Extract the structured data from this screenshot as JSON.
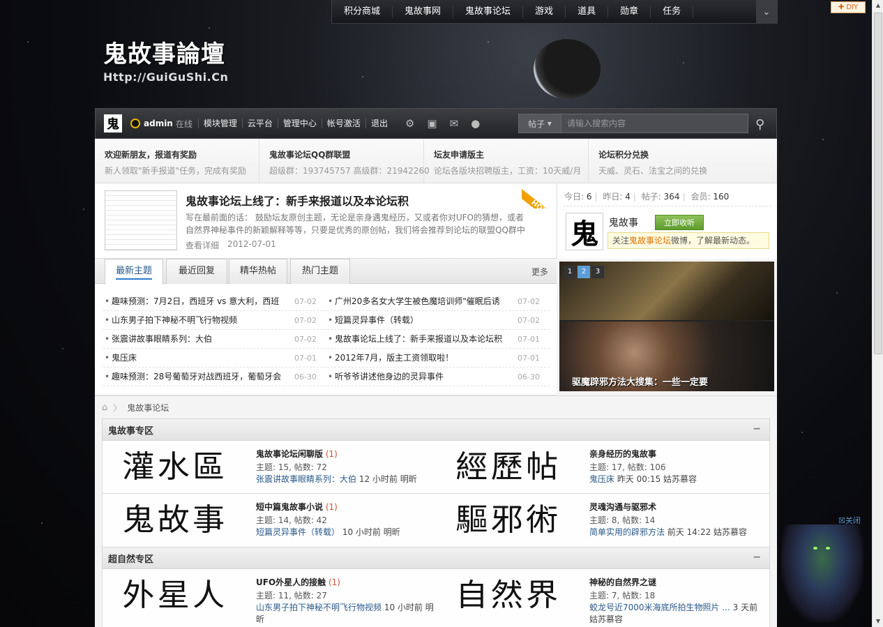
{
  "topnav": {
    "items": [
      "积分商城",
      "鬼故事网",
      "鬼故事论坛",
      "游戏",
      "道具",
      "勋章",
      "任务"
    ],
    "dropdown": "⌄",
    "diy": "✚ DIY"
  },
  "logo": {
    "title": "鬼故事論壇",
    "url": "Http://GuiGuShi.Cn"
  },
  "userbar": {
    "avatar_char": "鬼",
    "username": "admin",
    "status": "在线",
    "links": [
      "模块管理",
      "云平台",
      "管理中心",
      "帐号激活",
      "退出"
    ],
    "search_type": "帖子",
    "search_placeholder": "请输入搜索内容",
    "icons": [
      "gear-icon",
      "image-icon",
      "mail-icon",
      "bulb-icon",
      "search-icon"
    ]
  },
  "notices": [
    {
      "title": "欢迎新朋友，报道有奖励",
      "desc": "新人领取\"新手报道\"任务，完成有奖励"
    },
    {
      "title": "鬼故事论坛QQ群联盟",
      "desc": "超级群：193745757 高级群：21942260"
    },
    {
      "title": "坛友申请版主",
      "desc": "论坛各版块招聘版主，工资：10天威/月"
    },
    {
      "title": "论坛积分兑换",
      "desc": "天威、灵石、法宝之间的兑换"
    }
  ],
  "featured": {
    "title": "鬼故事论坛上线了：新手来报道以及本论坛积",
    "summary": "写在最前面的话： 鼓励坛友原创主题，无论是亲身遇鬼经历，又或者你对UFO的猜想，或者自然界神秘事件的新颖解释等等，只要是优秀的原创帖，我们将会推荐到论坛的联盟QQ群中 ...",
    "more": "查看详细",
    "date": "2012-07-01",
    "badge": "HOT"
  },
  "stats": {
    "today_label": "今日:",
    "today": "6",
    "yesterday_label": "昨日:",
    "yesterday": "4",
    "posts_label": "帖子:",
    "posts": "364",
    "members_label": "会员:",
    "members": "160",
    "weibo_char": "鬼",
    "weibo_name": "鬼故事",
    "listen": "立即收听",
    "follow_pre": "关注",
    "follow_hl": "鬼故事论坛",
    "follow_post": "微博，了解最新动态。"
  },
  "tabs": {
    "items": [
      "最新主题",
      "最近回复",
      "精华热帖",
      "热门主题"
    ],
    "more": "更多"
  },
  "threads": [
    [
      {
        "t": "趣味预测：7月2日，西班牙 vs 意大利，西班",
        "d": "07-02"
      },
      {
        "t": "广州20多名女大学生被色魔培训师\"催眠后诱",
        "d": "07-02"
      }
    ],
    [
      {
        "t": "山东男子拍下神秘不明飞行物视频",
        "d": "07-02"
      },
      {
        "t": "短篇灵异事件（转载）",
        "d": "07-02"
      }
    ],
    [
      {
        "t": "张震讲故事眼睛系列：大伯",
        "d": "07-02"
      },
      {
        "t": "鬼故事论坛上线了：新手来报道以及本论坛积",
        "d": "07-01"
      }
    ],
    [
      {
        "t": "鬼压床",
        "d": "07-01"
      },
      {
        "t": "2012年7月，版主工资领取啦！",
        "d": "07-01"
      }
    ],
    [
      {
        "t": "趣味预测：28号葡萄牙对战西班牙，葡萄牙会",
        "d": "06-30"
      },
      {
        "t": "听爷爷讲述他身边的灵异事件",
        "d": "06-30"
      }
    ]
  ],
  "slider": {
    "dots": [
      "1",
      "2",
      "3"
    ],
    "caption": "驱魔辟邪方法大搜集：一些一定要"
  },
  "breadcrumb": {
    "home": "⌂",
    "arrow": "〉",
    "current": "鬼故事论坛"
  },
  "sections": [
    {
      "title": "鬼故事专区",
      "collapse": "−",
      "forums": [
        {
          "glyph": "灌水區",
          "name": "鬼故事论坛闲聊版",
          "new": " (1)",
          "stat": "主题: 15, 帖数: 72",
          "last_link": "张震讲故事眼睛系列：大伯",
          "last_meta": " 12 小时前 明昕"
        },
        {
          "glyph": "經歷帖",
          "name": "亲身经历的鬼故事",
          "new": "",
          "stat": "主题: 17, 帖数: 106",
          "last_link": "鬼压床",
          "last_meta": " 昨天 00:15 姑苏慕容"
        },
        {
          "glyph": "鬼故事",
          "name": "短中篇鬼故事小说",
          "new": " (1)",
          "stat": "主题: 14, 帖数: 42",
          "last_link": "短篇灵异事件（转载）",
          "last_meta": " 10 小时前 明昕"
        },
        {
          "glyph": "驅邪術",
          "name": "灵魂沟通与驱邪术",
          "new": "",
          "stat": "主题: 8, 帖数: 14",
          "last_link": "简单实用的辟邪方法",
          "last_meta": " 前天 14:22 姑苏慕容"
        }
      ]
    },
    {
      "title": "超自然专区",
      "collapse": "−",
      "forums": [
        {
          "glyph": "外星人",
          "name": "UFO外星人的接触",
          "new": " (1)",
          "stat": "主题: 11, 帖数: 27",
          "last_link": "山东男子拍下神秘不明飞行物视频",
          "last_meta": " 10 小时前 明昕"
        },
        {
          "glyph": "自然界",
          "name": "神秘的自然界之谜",
          "new": "",
          "stat": "主题: 7, 帖数: 18",
          "last_link": "蛟龙号近7000米海底所拍生物照片 ...",
          "last_meta": " 3 天前 姑苏慕容"
        }
      ]
    }
  ],
  "ad": {
    "close": "☒关闭"
  }
}
